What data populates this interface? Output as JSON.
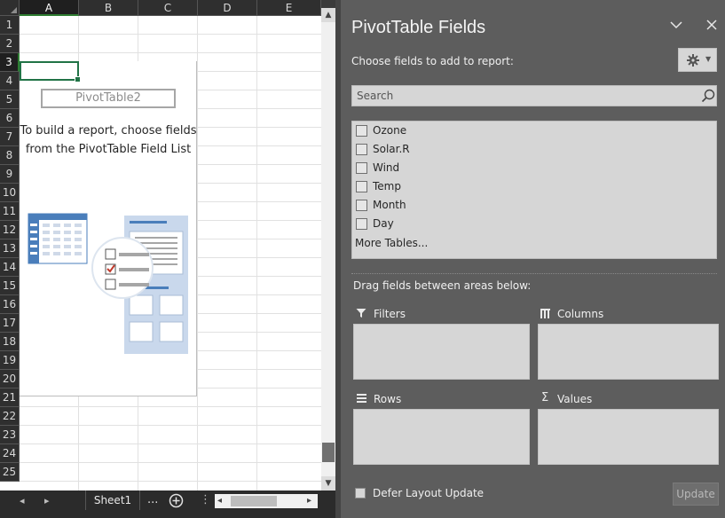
{
  "spreadsheet": {
    "columns": [
      "A",
      "B",
      "C",
      "D",
      "E"
    ],
    "rows": [
      "1",
      "2",
      "3",
      "4",
      "5",
      "6",
      "7",
      "8",
      "9",
      "10",
      "11",
      "12",
      "13",
      "14",
      "15",
      "16",
      "17",
      "18",
      "19",
      "20",
      "21",
      "22",
      "23",
      "24",
      "25"
    ],
    "selected_column": "A",
    "selected_row": "3"
  },
  "pivot_placeholder": {
    "name": "PivotTable2",
    "message_line1": "To build a report, choose fields",
    "message_line2": "from the PivotTable Field List"
  },
  "sheet_tabs": {
    "active": "Sheet1",
    "ellipsis": "...",
    "prev_icon": "scroll-left-icon",
    "next_icon": "scroll-right-icon",
    "add_icon": "add-sheet-icon"
  },
  "pane": {
    "title": "PivotTable Fields",
    "choose_label": "Choose fields to add to report:",
    "search_placeholder": "Search",
    "fields": [
      {
        "label": "Ozone",
        "checked": false
      },
      {
        "label": "Solar.R",
        "checked": false
      },
      {
        "label": "Wind",
        "checked": false
      },
      {
        "label": "Temp",
        "checked": false
      },
      {
        "label": "Month",
        "checked": false
      },
      {
        "label": "Day",
        "checked": false
      }
    ],
    "more_tables": "More Tables...",
    "drag_label": "Drag fields between areas below:",
    "areas": {
      "filters": "Filters",
      "columns": "Columns",
      "rows": "Rows",
      "values": "Values"
    },
    "defer_label": "Defer Layout Update",
    "defer_checked": false,
    "update_label": "Update"
  },
  "colors": {
    "pane_bg": "#5d5d5d",
    "box_bg": "#d6d6d6",
    "selection_green": "#217346",
    "illustration_blue": "#4a7ebb"
  }
}
